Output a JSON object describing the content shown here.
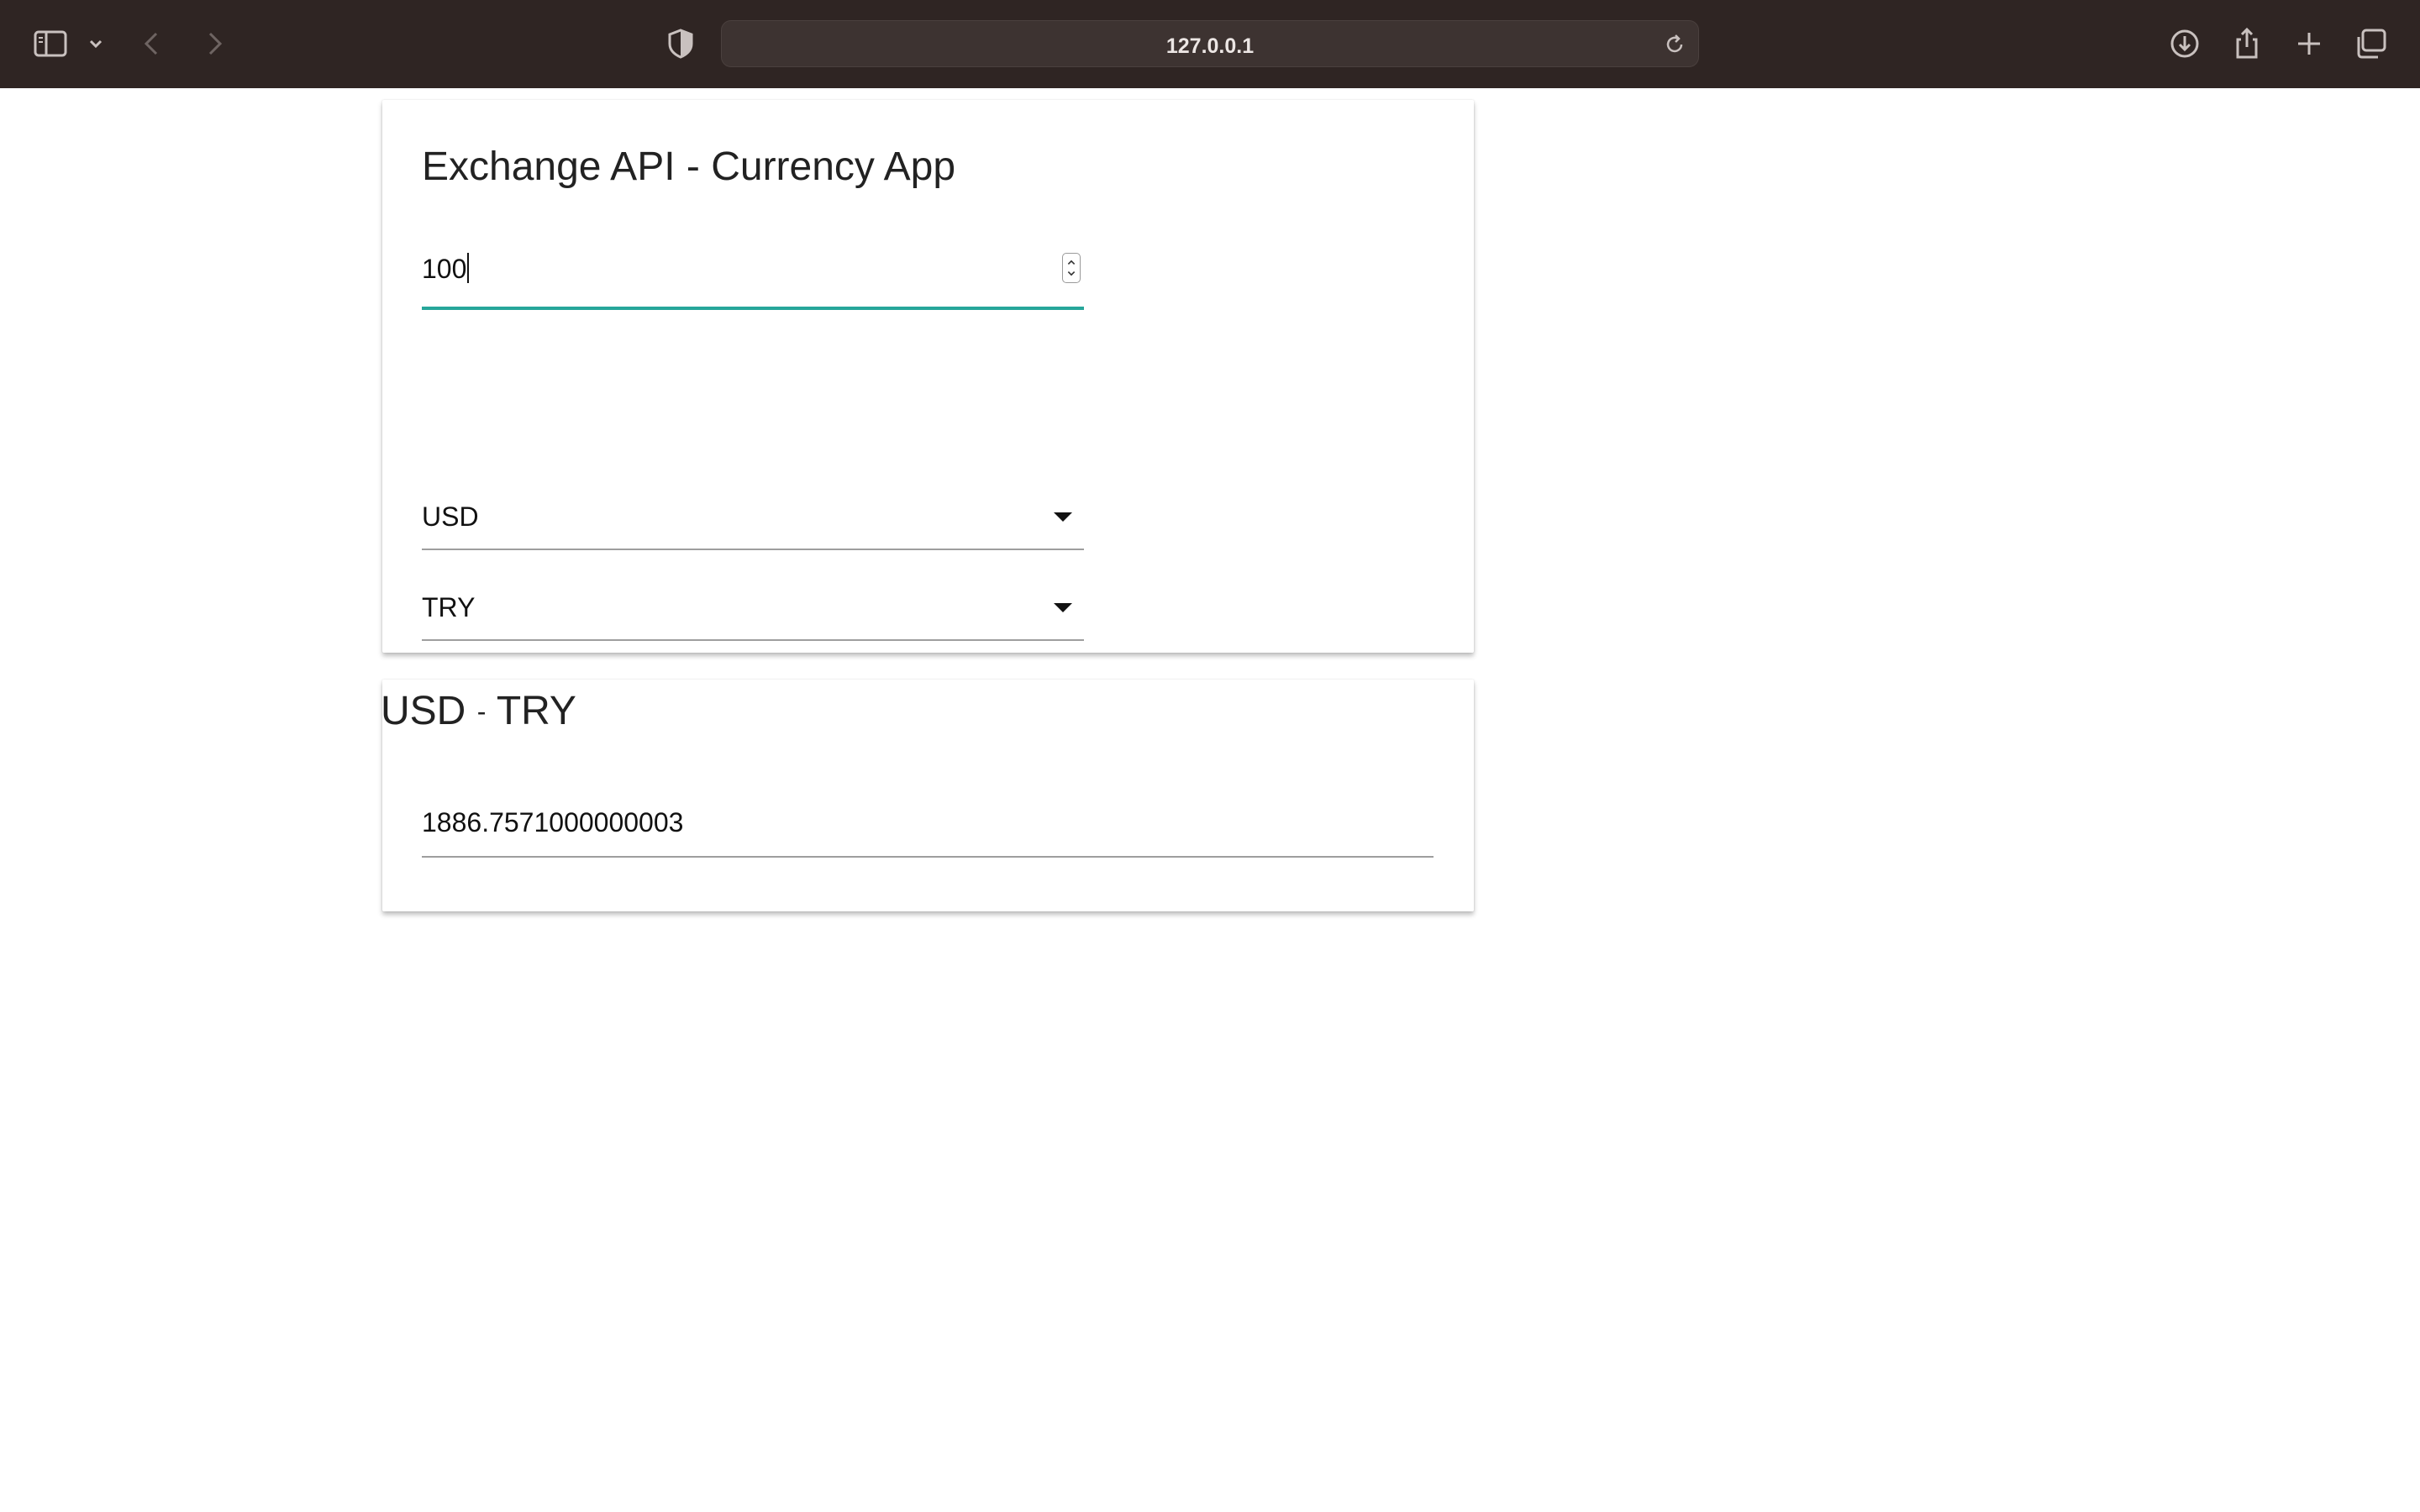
{
  "browser": {
    "url": "127.0.0.1",
    "icons": [
      "sidebar-icon",
      "chevron-down-icon",
      "back-icon",
      "forward-icon",
      "shield-icon",
      "reload-icon",
      "download-icon",
      "share-icon",
      "new-tab-icon",
      "tabs-overview-icon"
    ]
  },
  "app": {
    "title": "Exchange API - Currency App",
    "amount": "100",
    "from_currency": "USD",
    "to_currency": "TRY"
  },
  "result": {
    "from": "USD",
    "separator": "-",
    "to": "TRY",
    "value": "1886.7571000000003"
  },
  "colors": {
    "toolbar": "#2f2523",
    "accent": "#26a69a"
  }
}
